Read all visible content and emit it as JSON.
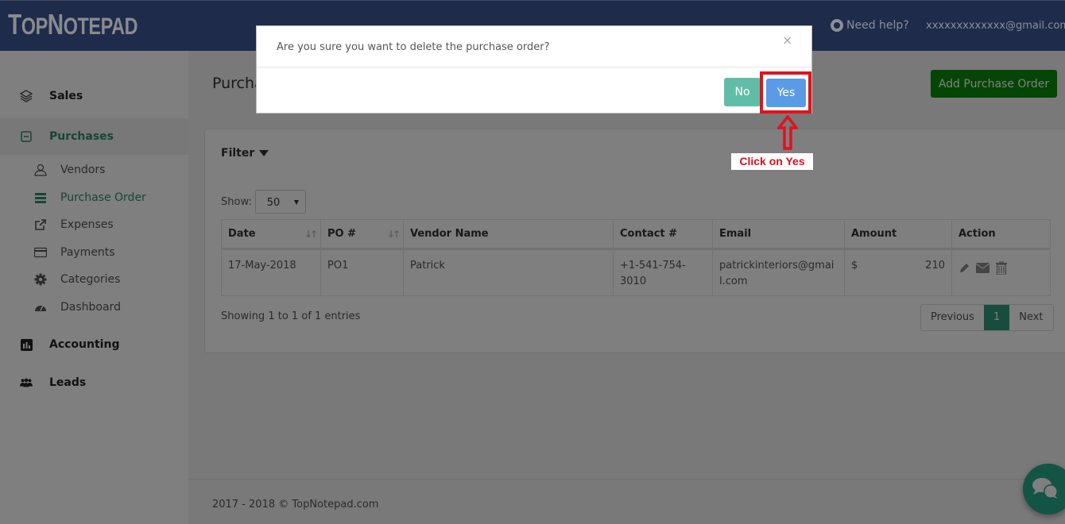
{
  "header": {
    "logo": "TopNotepad",
    "help_label": "Need help?",
    "user_email": "xxxxxxxxxxxxx@gmail.com"
  },
  "sidebar": {
    "main_items": [
      {
        "label": "Sales",
        "icon": "layers-icon"
      },
      {
        "label": "Purchases",
        "icon": "minus-square-icon",
        "active": true
      },
      {
        "label": "Accounting",
        "icon": "bar-chart-icon"
      },
      {
        "label": "Leads",
        "icon": "users-icon"
      }
    ],
    "sub_items": [
      {
        "label": "Vendors",
        "icon": "user-icon"
      },
      {
        "label": "Purchase Order",
        "icon": "list-icon",
        "active": true
      },
      {
        "label": "Expenses",
        "icon": "share-icon"
      },
      {
        "label": "Payments",
        "icon": "credit-card-icon"
      },
      {
        "label": "Categories",
        "icon": "gear-icon"
      },
      {
        "label": "Dashboard",
        "icon": "dashboard-icon"
      }
    ]
  },
  "main": {
    "page_title": "Purchase Order",
    "add_button": "Add Purchase Order",
    "filter_label": "Filter",
    "show_label": "Show:",
    "page_size": "50",
    "table": {
      "columns": [
        "Date",
        "PO #",
        "Vendor Name",
        "Contact #",
        "Email",
        "Amount",
        "Action"
      ],
      "rows": [
        {
          "date": "17-May-2018",
          "po": "PO1",
          "vendor": "Patrick",
          "contact": "+1-541-754-3010",
          "email": "patrickinteriors@gmail.com",
          "currency": "$",
          "amount": "210"
        }
      ]
    },
    "showing_text": "Showing 1 to 1 of 1 entries",
    "pagination": {
      "previous": "Previous",
      "current": "1",
      "next": "Next"
    },
    "footer": "2017 - 2018 © TopNotepad.com"
  },
  "modal": {
    "message": "Are you sure you want to delete the purchase order?",
    "close": "×",
    "no_label": "No",
    "yes_label": "Yes"
  },
  "annotation": {
    "label": "Click on Yes",
    "color": "#e0121e"
  }
}
